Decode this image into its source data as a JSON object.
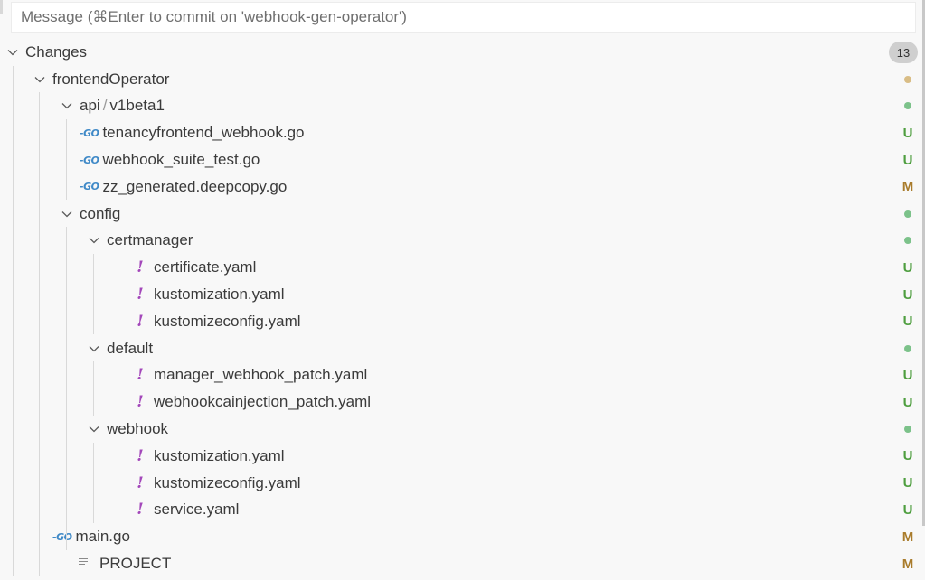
{
  "commit": {
    "placeholder": "Message (⌘Enter to commit on 'webhook-gen-operator')"
  },
  "changes": {
    "label": "Changes",
    "count": "13"
  },
  "tree": [
    {
      "label": "frontendOperator",
      "type": "folder",
      "depth": 1,
      "status": "dot",
      "status_color": "#d9bd86"
    },
    {
      "label_parts": [
        "api",
        "v1beta1"
      ],
      "type": "folder",
      "depth": 2,
      "status": "dot",
      "status_color": "#7cc28a"
    },
    {
      "label": "tenancyfrontend_webhook.go",
      "type": "go",
      "depth": 3,
      "status": "U"
    },
    {
      "label": "webhook_suite_test.go",
      "type": "go",
      "depth": 3,
      "status": "U"
    },
    {
      "label": "zz_generated.deepcopy.go",
      "type": "go",
      "depth": 3,
      "status": "M"
    },
    {
      "label": "config",
      "type": "folder",
      "depth": 2,
      "status": "dot",
      "status_color": "#7cc28a"
    },
    {
      "label": "certmanager",
      "type": "folder",
      "depth": 3,
      "status": "dot",
      "status_color": "#7cc28a"
    },
    {
      "label": "certificate.yaml",
      "type": "yaml",
      "depth": 4,
      "status": "U"
    },
    {
      "label": "kustomization.yaml",
      "type": "yaml",
      "depth": 4,
      "status": "U"
    },
    {
      "label": "kustomizeconfig.yaml",
      "type": "yaml",
      "depth": 4,
      "status": "U"
    },
    {
      "label": "default",
      "type": "folder",
      "depth": 3,
      "status": "dot",
      "status_color": "#7cc28a"
    },
    {
      "label": "manager_webhook_patch.yaml",
      "type": "yaml",
      "depth": 4,
      "status": "U"
    },
    {
      "label": "webhookcainjection_patch.yaml",
      "type": "yaml",
      "depth": 4,
      "status": "U"
    },
    {
      "label": "webhook",
      "type": "folder",
      "depth": 3,
      "status": "dot",
      "status_color": "#7cc28a"
    },
    {
      "label": "kustomization.yaml",
      "type": "yaml",
      "depth": 4,
      "status": "U"
    },
    {
      "label": "kustomizeconfig.yaml",
      "type": "yaml",
      "depth": 4,
      "status": "U"
    },
    {
      "label": "service.yaml",
      "type": "yaml",
      "depth": 4,
      "status": "U"
    },
    {
      "label": "main.go",
      "type": "go",
      "depth": 2,
      "status": "M"
    },
    {
      "label": "PROJECT",
      "type": "text",
      "depth": 2,
      "status": "M"
    }
  ],
  "icons": {
    "go": "GO",
    "yaml": "!",
    "chevron": "chevron-down-icon",
    "text": "lines-icon"
  },
  "colors": {
    "untracked": "#4e9e3f",
    "modified": "#a97c2c",
    "go_icon": "#3f89c7",
    "yaml_icon": "#a347ba"
  }
}
